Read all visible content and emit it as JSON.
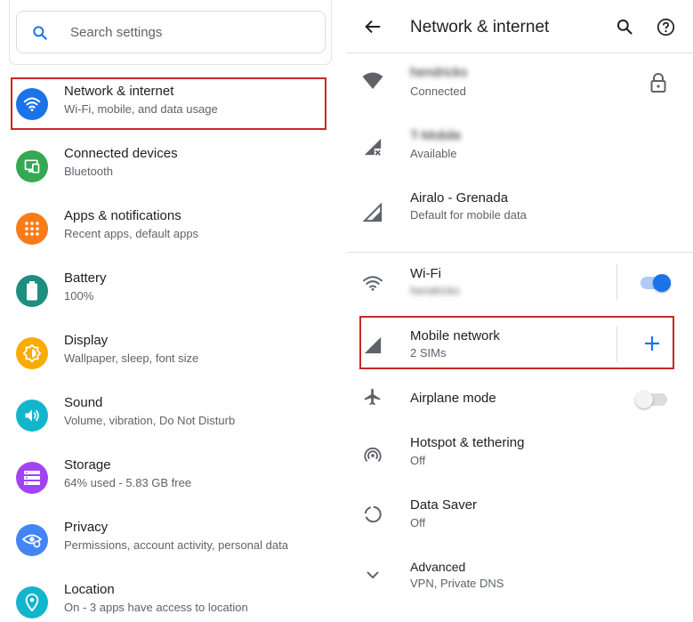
{
  "left": {
    "search_placeholder": "Search settings",
    "items": [
      {
        "title": "Network & internet",
        "sub": "Wi-Fi, mobile, and data usage",
        "icon": "wifi-icon",
        "color": "#1a73e8"
      },
      {
        "title": "Connected devices",
        "sub": "Bluetooth",
        "icon": "devices-icon",
        "color": "#34a853"
      },
      {
        "title": "Apps & notifications",
        "sub": "Recent apps, default apps",
        "icon": "apps-icon",
        "color": "#fa7b17"
      },
      {
        "title": "Battery",
        "sub": "100%",
        "icon": "battery-icon",
        "color": "#1e8e7e"
      },
      {
        "title": "Display",
        "sub": "Wallpaper, sleep, font size",
        "icon": "brightness-icon",
        "color": "#f9ab00"
      },
      {
        "title": "Sound",
        "sub": "Volume, vibration, Do Not Disturb",
        "icon": "volume-icon",
        "color": "#12b5cb"
      },
      {
        "title": "Storage",
        "sub": "64% used - 5.83 GB free",
        "icon": "storage-icon",
        "color": "#a142f4"
      },
      {
        "title": "Privacy",
        "sub": "Permissions, account activity, personal data",
        "icon": "eye-icon",
        "color": "#4285f4"
      },
      {
        "title": "Location",
        "sub": "On - 3 apps have access to location",
        "icon": "location-pin-icon",
        "color": "#12b5cb"
      }
    ]
  },
  "right": {
    "title": "Network & internet",
    "networks": [
      {
        "title": "hendricks",
        "sub": "Connected"
      },
      {
        "title": "T-Mobile",
        "sub": "Available"
      },
      {
        "title": "Airalo - Grenada",
        "sub": "Default for mobile data"
      }
    ],
    "wifi": {
      "title": "Wi-Fi",
      "sub": "hendricks",
      "on": true
    },
    "mobile": {
      "title": "Mobile network",
      "sub": "2 SIMs"
    },
    "airplane": {
      "title": "Airplane mode",
      "on": false
    },
    "hotspot": {
      "title": "Hotspot & tethering",
      "sub": "Off"
    },
    "datasaver": {
      "title": "Data Saver",
      "sub": "Off"
    },
    "advanced": {
      "title": "Advanced",
      "sub": "VPN, Private DNS"
    }
  },
  "colors": {
    "accent": "#1a73e8",
    "highlight": "#c62828",
    "icon_gray": "#5f6368"
  }
}
